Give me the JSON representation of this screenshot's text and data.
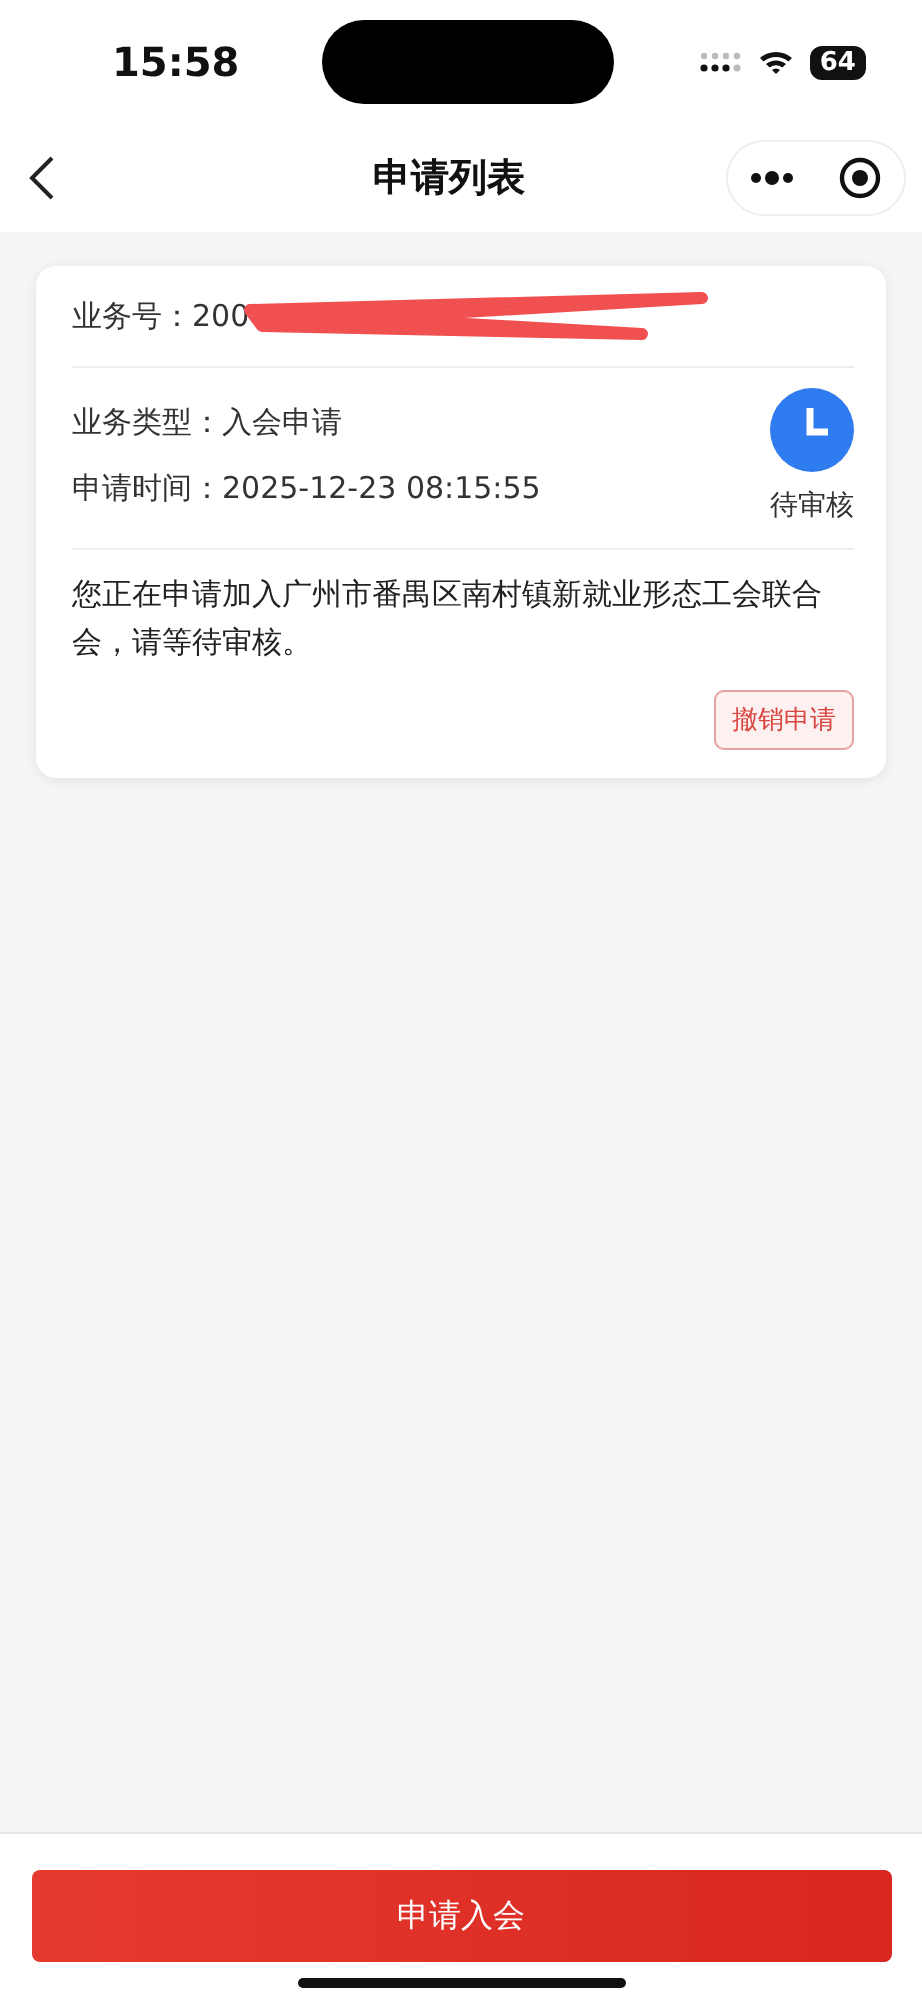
{
  "status_bar": {
    "time": "15:58",
    "battery": "64"
  },
  "nav": {
    "title": "申请列表"
  },
  "applications": [
    {
      "number_label": "业务号：",
      "number": "200",
      "type_label": "业务类型：",
      "type": "入会申请",
      "time_label": "申请时间：",
      "time": "2025-12-23 08:15:55",
      "status": "待审核",
      "kind": "pending",
      "message": "您正在申请加入广州市番禺区南村镇新就业形态工会联合会，请等待审核。",
      "action": "撤销申请"
    }
  ],
  "bottom_button": "申请入会"
}
